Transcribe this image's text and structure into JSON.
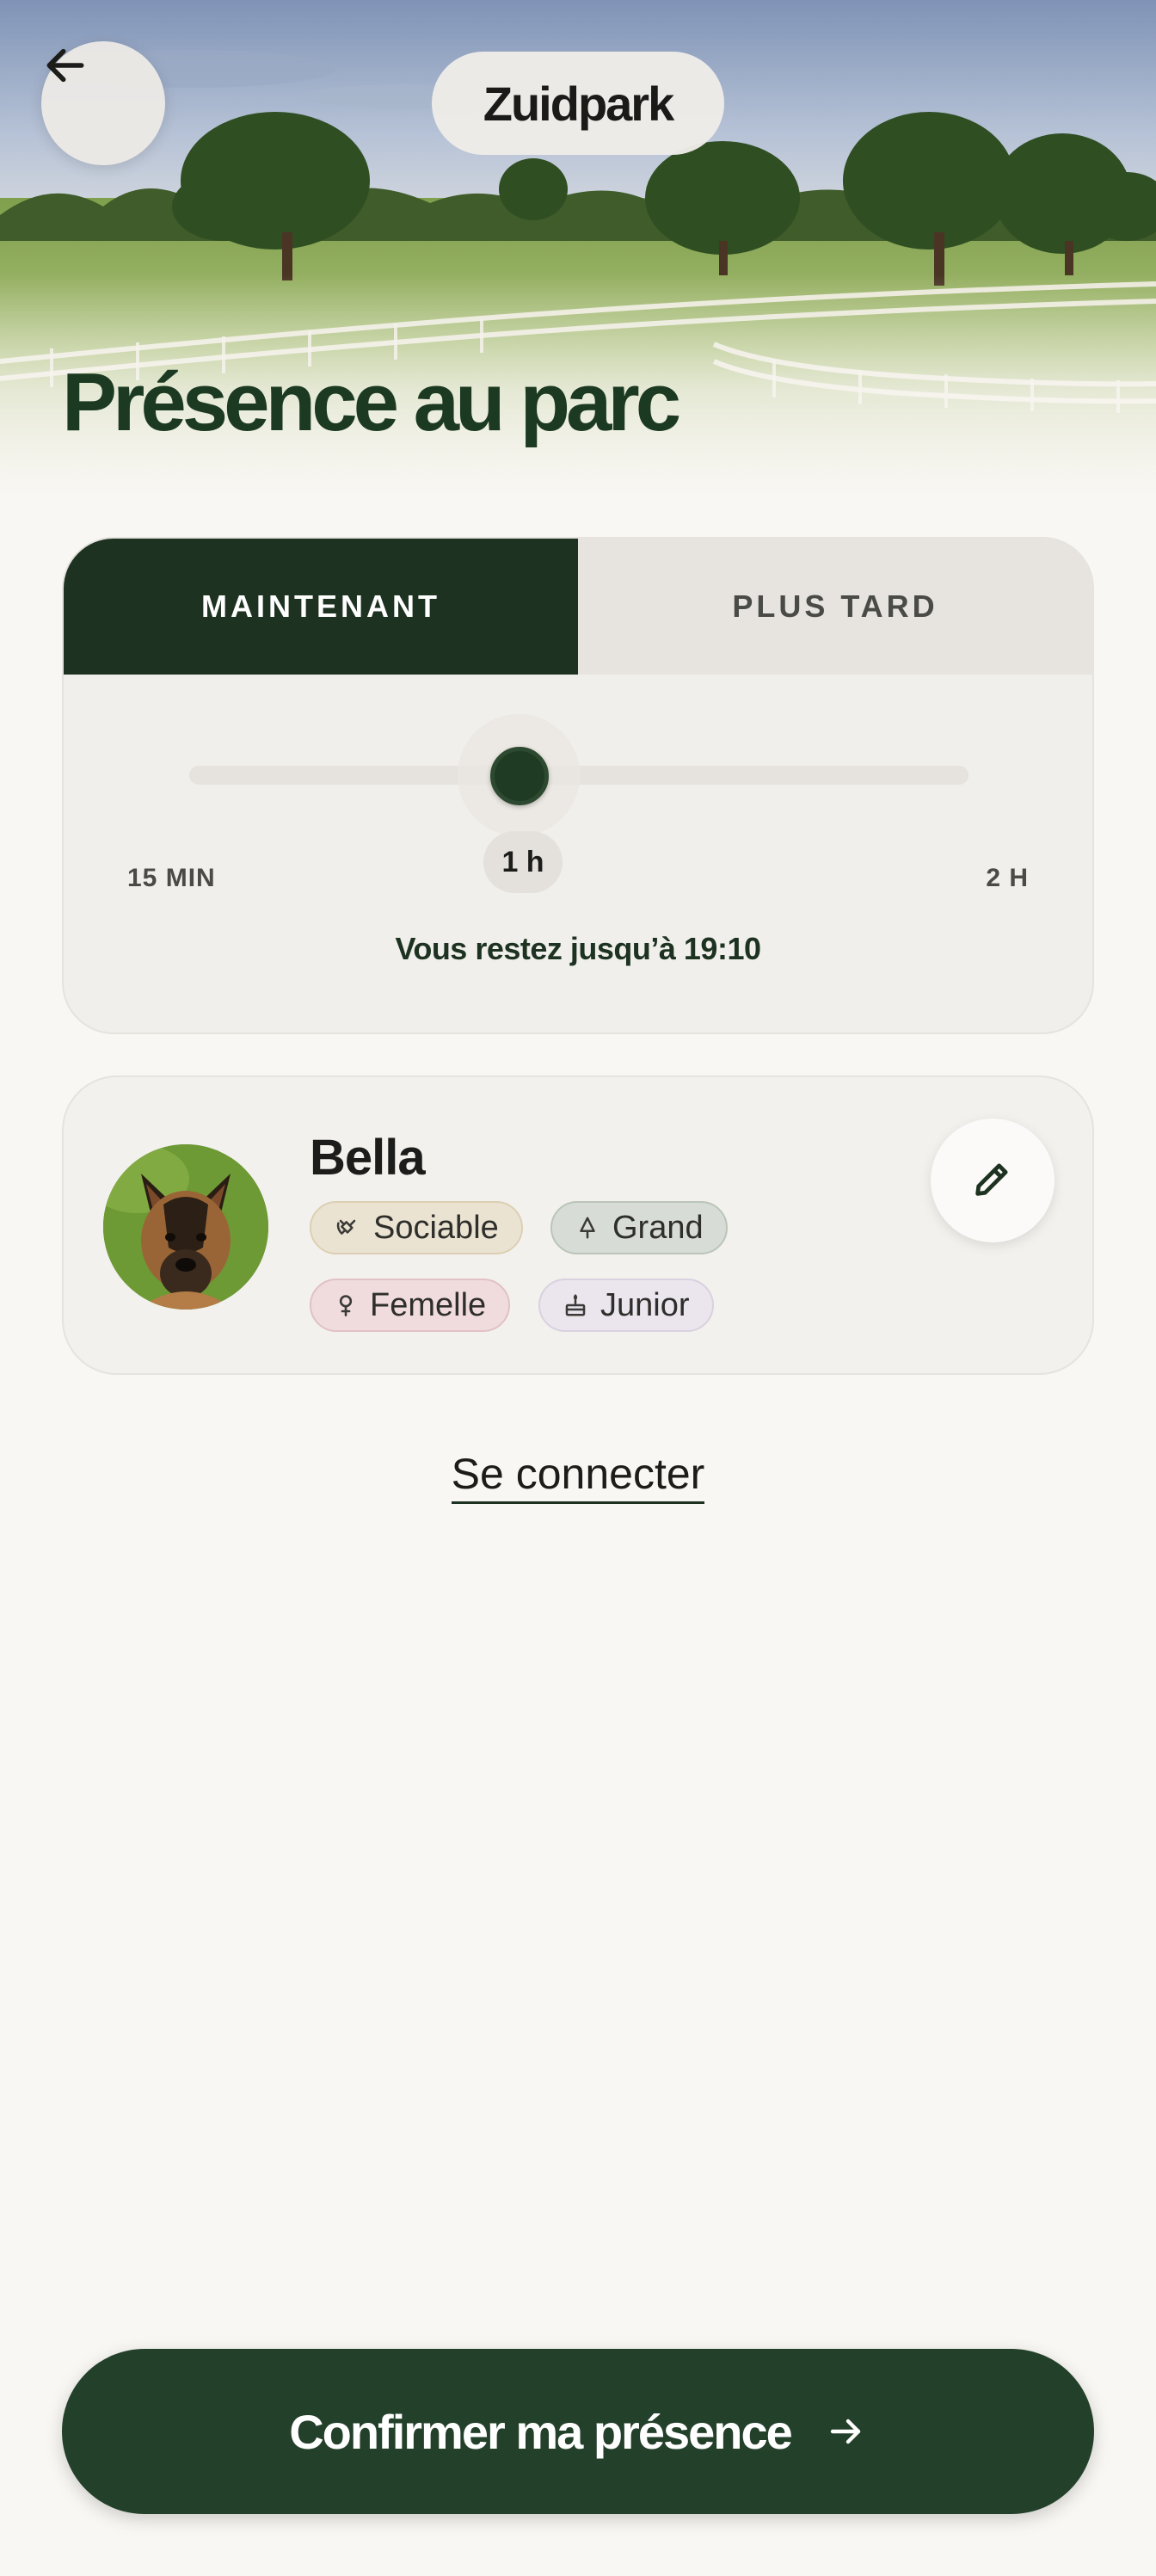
{
  "header": {
    "park_name": "Zuidpark",
    "title": "Présence au parc"
  },
  "duration": {
    "tabs": [
      {
        "label": "MAINTENANT",
        "active": true
      },
      {
        "label": "PLUS TARD",
        "active": false
      }
    ],
    "slider_value_label": "1 h",
    "slider_fraction": 0.4,
    "range_min_label": "15 MIN",
    "range_max_label": "2 H",
    "until_text": "Vous restez jusqu’à 19:10"
  },
  "dog": {
    "name": "Bella",
    "tags": [
      {
        "label": "Sociable",
        "icon": "handshake-icon"
      },
      {
        "label": "Grand",
        "icon": "tree-icon"
      },
      {
        "label": "Femelle",
        "icon": "female-icon"
      },
      {
        "label": "Junior",
        "icon": "cake-icon"
      }
    ]
  },
  "login_label": "Se connecter",
  "confirm_label": "Confirmer ma présence",
  "colors": {
    "primary_dark": "#1d3220",
    "button_green": "#23402a",
    "title_green": "#1c3a22",
    "background": "#f9f7f3"
  }
}
